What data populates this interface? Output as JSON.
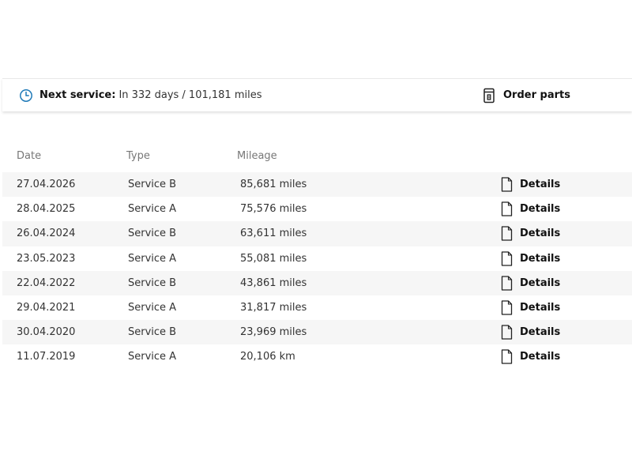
{
  "service_bar": {
    "next_label": "Next service:",
    "next_value": "In 332 days / 101,181 miles",
    "order_parts_label": "Order parts",
    "clock_icon": "clock-icon",
    "parts_icon": "order-parts-icon",
    "accent_color": "#1f7ab8"
  },
  "table": {
    "headers": {
      "date": "Date",
      "type": "Type",
      "mileage": "Mileage"
    },
    "rows": [
      {
        "date": "27.04.2026",
        "type": "Service B",
        "mileage": "85,681 miles",
        "action": "Details"
      },
      {
        "date": "28.04.2025",
        "type": "Service A",
        "mileage": "75,576 miles",
        "action": "Details"
      },
      {
        "date": "26.04.2024",
        "type": "Service B",
        "mileage": "63,611 miles",
        "action": "Details"
      },
      {
        "date": "23.05.2023",
        "type": "Service A",
        "mileage": "55,081 miles",
        "action": "Details"
      },
      {
        "date": "22.04.2022",
        "type": "Service B",
        "mileage": "43,861 miles",
        "action": "Details"
      },
      {
        "date": "29.04.2021",
        "type": "Service A",
        "mileage": "31,817 miles",
        "action": "Details"
      },
      {
        "date": "30.04.2020",
        "type": "Service B",
        "mileage": "23,969 miles",
        "action": "Details"
      },
      {
        "date": "11.07.2019",
        "type": "Service A",
        "mileage": "20,106 km",
        "action": "Details"
      }
    ],
    "row_alt_color": "#f6f6f6",
    "details_icon": "document-icon"
  }
}
